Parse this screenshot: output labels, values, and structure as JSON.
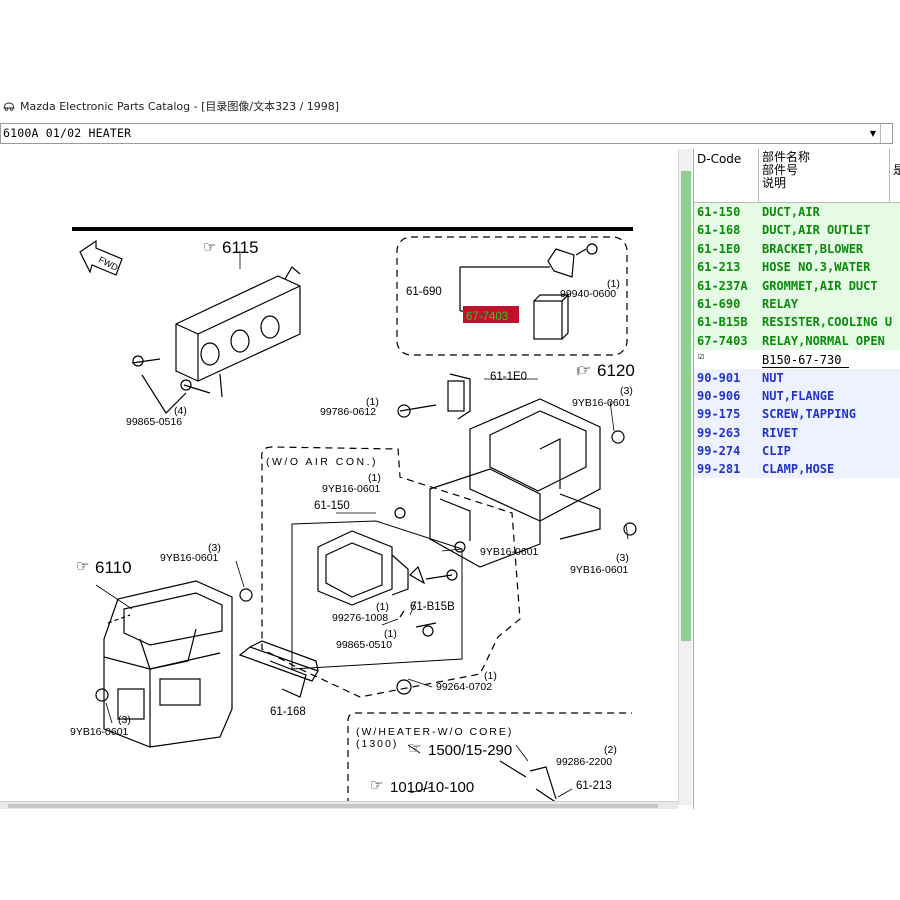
{
  "window": {
    "title": "Mazda Electronic Parts Catalog - [目录图像/文本323 / 1998]",
    "icon": "car-icon"
  },
  "selector": {
    "value": "6100A 01/02 HEATER",
    "arrow": "▼",
    "icon": "chevron-down-icon"
  },
  "diagram": {
    "fwd_label": "FWD",
    "ref_6115": "6115",
    "ref_6120": "6120",
    "ref_6110": "6110",
    "ref_1500": "1500/15-290",
    "ref_1010": "1010/10-100",
    "part_61_690": "61-690",
    "part_67_7403": "67-7403",
    "part_99940": "99940-0600",
    "qty_1a": "(1)",
    "part_61_1E0": "61-1E0",
    "part_99786": "99786-0612",
    "qty_1b": "(1)",
    "part_9YB16_a": "9YB16-0601",
    "qty_3a": "(3)",
    "part_99865_a": "99865-0516",
    "qty_4": "(4)",
    "wo_air_con": "(W/O AIR CON.)",
    "part_9YB16_b": "9YB16-0601",
    "qty_1c": "(1)",
    "part_61_150": "61-150",
    "part_9YB16_c": "9YB16-0601",
    "part_9YB16_d": "9YB16-0601",
    "qty_3d": "(3)",
    "part_9YB16_e": "9YB16-0601",
    "qty_3e": "(3)",
    "part_99276": "99276-1008",
    "qty_1f": "(1)",
    "part_61_B15B": "61-B15B",
    "part_99865_b": "99865-0510",
    "qty_1g": "(1)",
    "part_99264": "99264-0702",
    "qty_1h": "(1)",
    "part_61_168": "61-168",
    "part_9YB16_f": "9YB16-0601",
    "qty_3f": "(3)",
    "wo_core_line1": "(W/HEATER-W/O CORE)",
    "wo_core_line2": "(1300)",
    "part_99286": "99286-2200",
    "qty_2": "(2)",
    "part_61_213": "61-213"
  },
  "panel": {
    "header": {
      "code_label": "D-Code",
      "name_line1": "部件名称",
      "name_line2": "部件号",
      "name_line3": "说明",
      "extra": "是"
    },
    "rows": [
      {
        "code": "61-150",
        "name": "DUCT,AIR",
        "color": "green"
      },
      {
        "code": "61-168",
        "name": "DUCT,AIR OUTLET",
        "color": "green"
      },
      {
        "code": "61-1E0",
        "name": "BRACKET,BLOWER",
        "color": "green"
      },
      {
        "code": "61-213",
        "name": "HOSE NO.3,WATER",
        "color": "green"
      },
      {
        "code": "61-237A",
        "name": "GROMMET,AIR DUCT",
        "color": "green"
      },
      {
        "code": "61-690",
        "name": "RELAY",
        "color": "green"
      },
      {
        "code": "61-B15B",
        "name": "RESISTER,COOLING U",
        "color": "green"
      },
      {
        "code": "67-7403",
        "name": "RELAY,NORMAL OPEN",
        "color": "green"
      },
      {
        "code": "",
        "name": "B150-67-730",
        "color": "plain",
        "checked": true
      },
      {
        "code": "90-901",
        "name": "NUT",
        "color": "blue"
      },
      {
        "code": "90-906",
        "name": "NUT,FLANGE",
        "color": "blue"
      },
      {
        "code": "99-175",
        "name": "SCREW,TAPPING",
        "color": "blue"
      },
      {
        "code": "99-263",
        "name": "RIVET",
        "color": "blue"
      },
      {
        "code": "99-274",
        "name": "CLIP",
        "color": "blue"
      },
      {
        "code": "99-281",
        "name": "CLAMP,HOSE",
        "color": "blue"
      }
    ],
    "check_glyph": "☑"
  },
  "colors": {
    "green_text": "#0b8a0b",
    "green_bg": "#e6fbe6",
    "blue_text": "#2233cc",
    "highlight": "#c0102a",
    "highlight_text": "#1fd01f"
  }
}
